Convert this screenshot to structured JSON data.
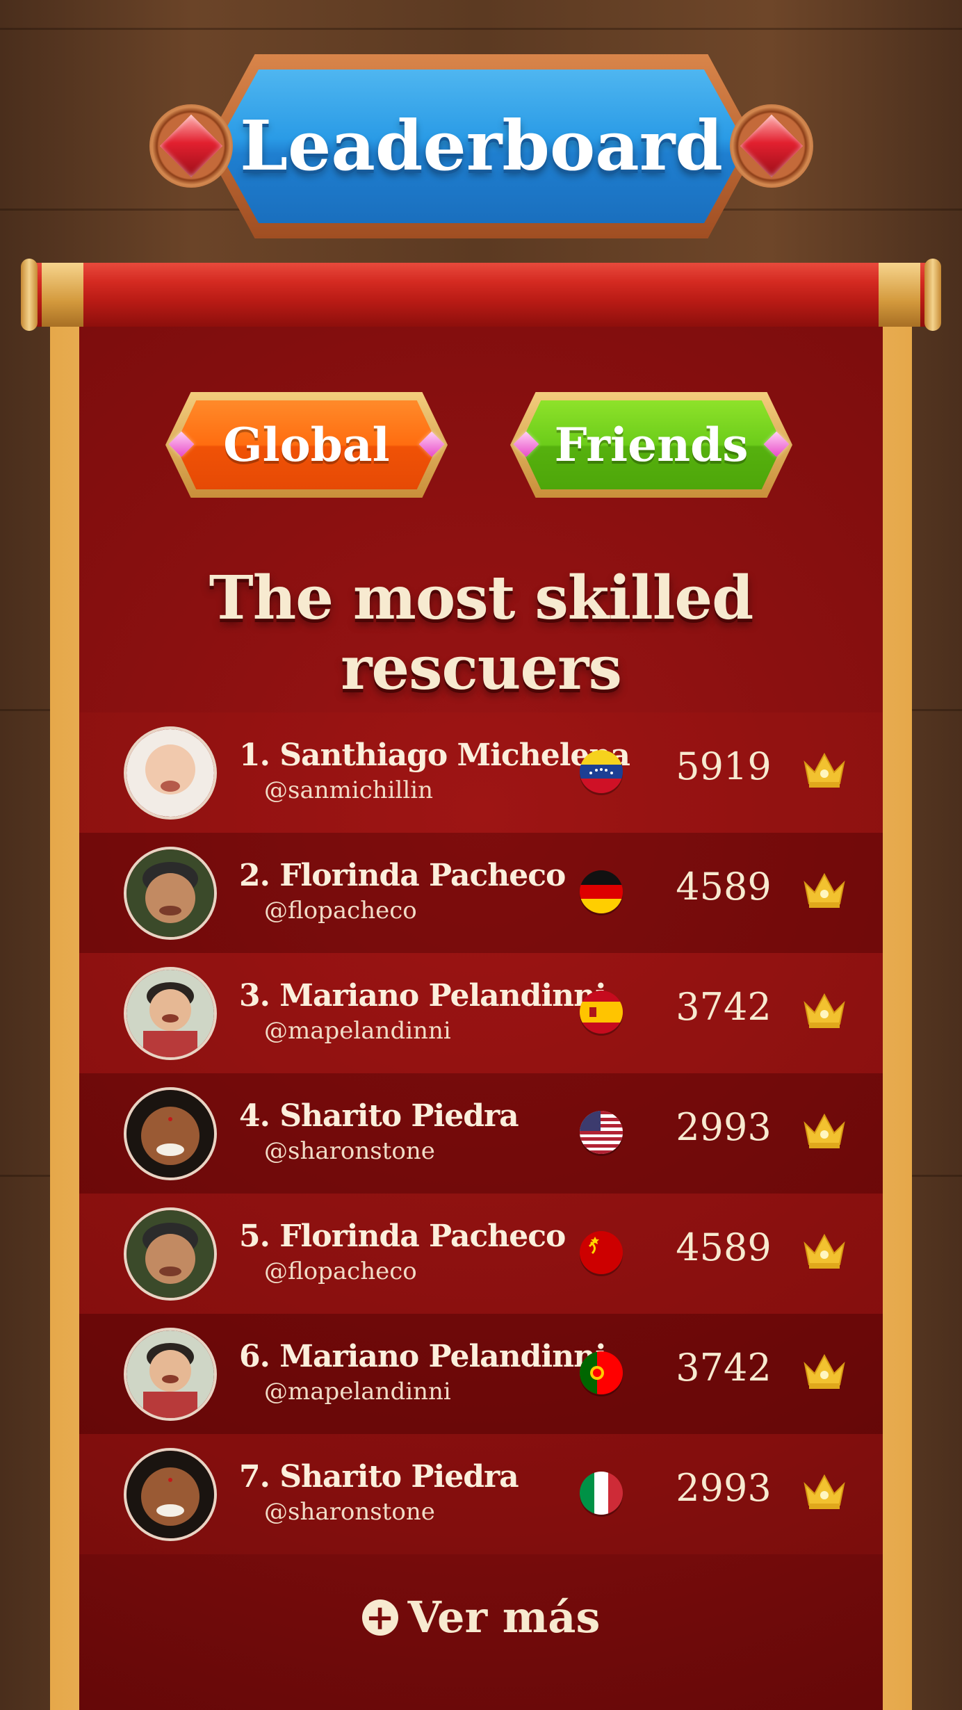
{
  "title": "Leaderboard",
  "tabs": [
    {
      "label": "Global"
    },
    {
      "label": "Friends"
    }
  ],
  "subtitle": "The most skilled rescuers",
  "players": [
    {
      "rank": "1.",
      "name": "Santhiago Michelena",
      "handle": "@sanmichillin",
      "country_flag": "venezuela",
      "score": "5919"
    },
    {
      "rank": "2.",
      "name": "Florinda Pacheco",
      "handle": "@flopacheco",
      "country_flag": "germany",
      "score": "4589"
    },
    {
      "rank": "3.",
      "name": "Mariano Pelandinni",
      "handle": "@mapelandinni",
      "country_flag": "spain",
      "score": "3742"
    },
    {
      "rank": "4.",
      "name": "Sharito Piedra",
      "handle": "@sharonstone",
      "country_flag": "usa",
      "score": "2993"
    },
    {
      "rank": "5.",
      "name": "Florinda Pacheco",
      "handle": "@flopacheco",
      "country_flag": "ussr",
      "score": "4589"
    },
    {
      "rank": "6.",
      "name": "Mariano Pelandinni",
      "handle": "@mapelandinni",
      "country_flag": "portugal",
      "score": "3742"
    },
    {
      "rank": "7.",
      "name": "Sharito Piedra",
      "handle": "@sharonstone",
      "country_flag": "italy",
      "score": "2993"
    }
  ],
  "more_label": "Ver más",
  "colors": {
    "title_blue": "#2a9be6",
    "scroll_red": "#7a0c0c",
    "tab_global": "#ff6d10",
    "tab_friends": "#6ccc1a",
    "gold": "#f2c230"
  },
  "icons": [
    "ruby-gem-icon",
    "pink-diamond-icon",
    "crown-icon",
    "plus-circle-icon"
  ]
}
